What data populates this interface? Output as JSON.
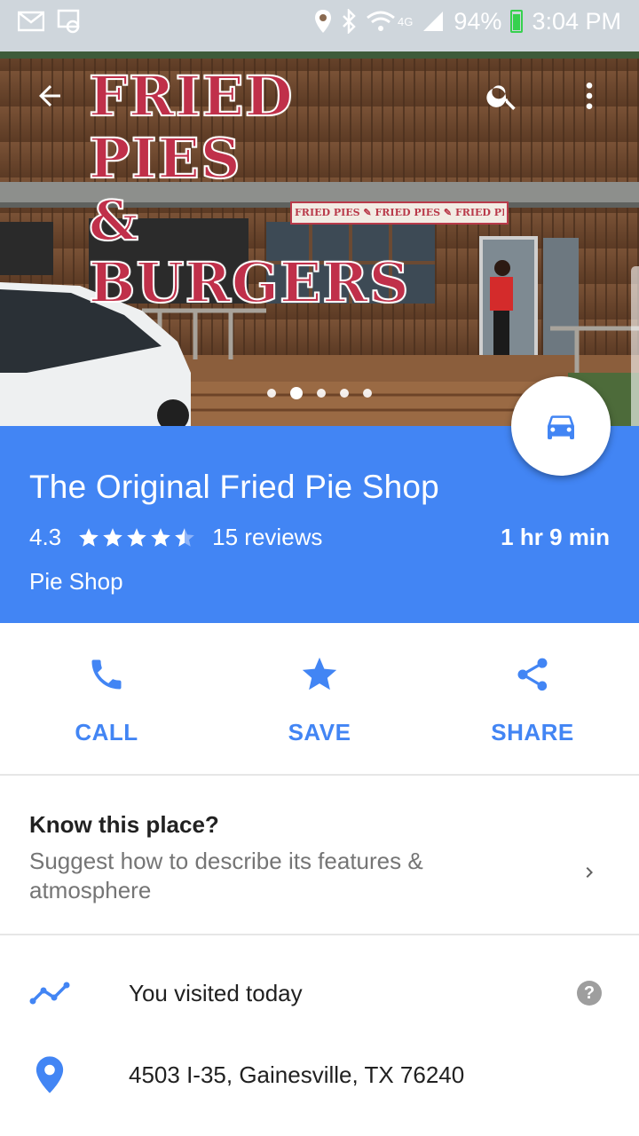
{
  "status_bar": {
    "time": "3:04 PM",
    "battery": "94%",
    "network": "4G"
  },
  "hero": {
    "sign_line1": "FRIED PIES",
    "sign_line2": "& BURGERS",
    "banner": "FRIED PIES ✎ FRIED PIES ✎ FRIED PIES",
    "photo_count": 5,
    "active_photo": 2
  },
  "appbar": {
    "back_icon": "arrow-back-icon",
    "search_icon": "search-icon",
    "more_icon": "more-vert-icon"
  },
  "place": {
    "name": "The Original Fried Pie Shop",
    "rating": "4.3",
    "stars": 4.3,
    "reviews": "15 reviews",
    "travel_time": "1 hr 9 min",
    "category": "Pie Shop",
    "directions_icon": "car-icon"
  },
  "actions": [
    {
      "label": "CALL",
      "icon": "phone-icon"
    },
    {
      "label": "SAVE",
      "icon": "star-icon"
    },
    {
      "label": "SHARE",
      "icon": "share-icon"
    }
  ],
  "know_place": {
    "title": "Know this place?",
    "subtitle": "Suggest how to describe its features & atmosphere"
  },
  "info": {
    "visited": "You visited today",
    "address": "4503 I-35, Gainesville, TX 76240"
  },
  "colors": {
    "brand_blue": "#4285f4",
    "divider": "#e6e6e6",
    "secondary_text": "#757575"
  }
}
